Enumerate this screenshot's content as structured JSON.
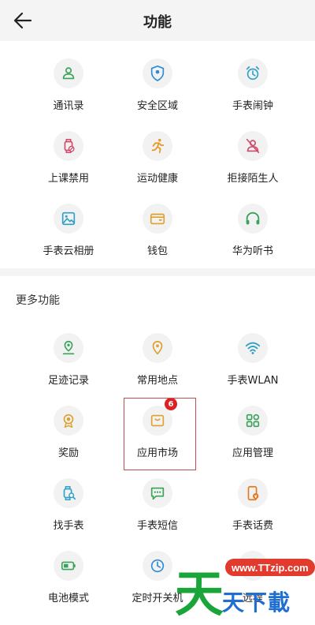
{
  "header": {
    "title": "功能",
    "back_icon": "arrow-left-icon"
  },
  "top_features": [
    {
      "label": "通讯录",
      "icon": "contacts-icon",
      "color": "#3aa35a"
    },
    {
      "label": "安全区域",
      "icon": "safe-zone-icon",
      "color": "#2d8bd8"
    },
    {
      "label": "手表闹钟",
      "icon": "alarm-clock-icon",
      "color": "#2fa0c8"
    },
    {
      "label": "上课禁用",
      "icon": "class-disable-watch-icon",
      "color": "#d24a6a"
    },
    {
      "label": "运动健康",
      "icon": "running-icon",
      "color": "#e89b2a"
    },
    {
      "label": "拒接陌生人",
      "icon": "reject-stranger-icon",
      "color": "#d24a6a"
    },
    {
      "label": "手表云相册",
      "icon": "photo-album-icon",
      "color": "#2fa0c8"
    },
    {
      "label": "钱包",
      "icon": "wallet-icon",
      "color": "#e0a030"
    },
    {
      "label": "华为听书",
      "icon": "headphones-icon",
      "color": "#3aa35a"
    }
  ],
  "more": {
    "title": "更多功能",
    "items": [
      {
        "label": "足迹记录",
        "icon": "footprint-location-icon",
        "color": "#3aa35a"
      },
      {
        "label": "常用地点",
        "icon": "map-pin-icon",
        "color": "#e0a030"
      },
      {
        "label": "手表WLAN",
        "icon": "wifi-icon",
        "color": "#2fa0c8"
      },
      {
        "label": "奖励",
        "icon": "medal-icon",
        "color": "#e0a030"
      },
      {
        "label": "应用市场",
        "icon": "app-market-bag-icon",
        "color": "#e0a030",
        "badge": "6"
      },
      {
        "label": "应用管理",
        "icon": "app-grid-icon",
        "color": "#3aa35a"
      },
      {
        "label": "找手表",
        "icon": "find-watch-icon",
        "color": "#2fa0c8"
      },
      {
        "label": "手表短信",
        "icon": "message-bubble-icon",
        "color": "#3aa35a"
      },
      {
        "label": "手表话费",
        "icon": "phone-bill-icon",
        "color": "#e07a20"
      },
      {
        "label": "电池模式",
        "icon": "battery-icon",
        "color": "#3aa35a"
      },
      {
        "label": "定时开关机",
        "icon": "timer-clock-icon",
        "color": "#2d8bd8"
      },
      {
        "label": "远程",
        "icon": "remote-icon",
        "color": "#3aa35a"
      }
    ]
  },
  "watermark": {
    "big": "天",
    "url": "www.TTzip.com",
    "small": "天下載"
  }
}
